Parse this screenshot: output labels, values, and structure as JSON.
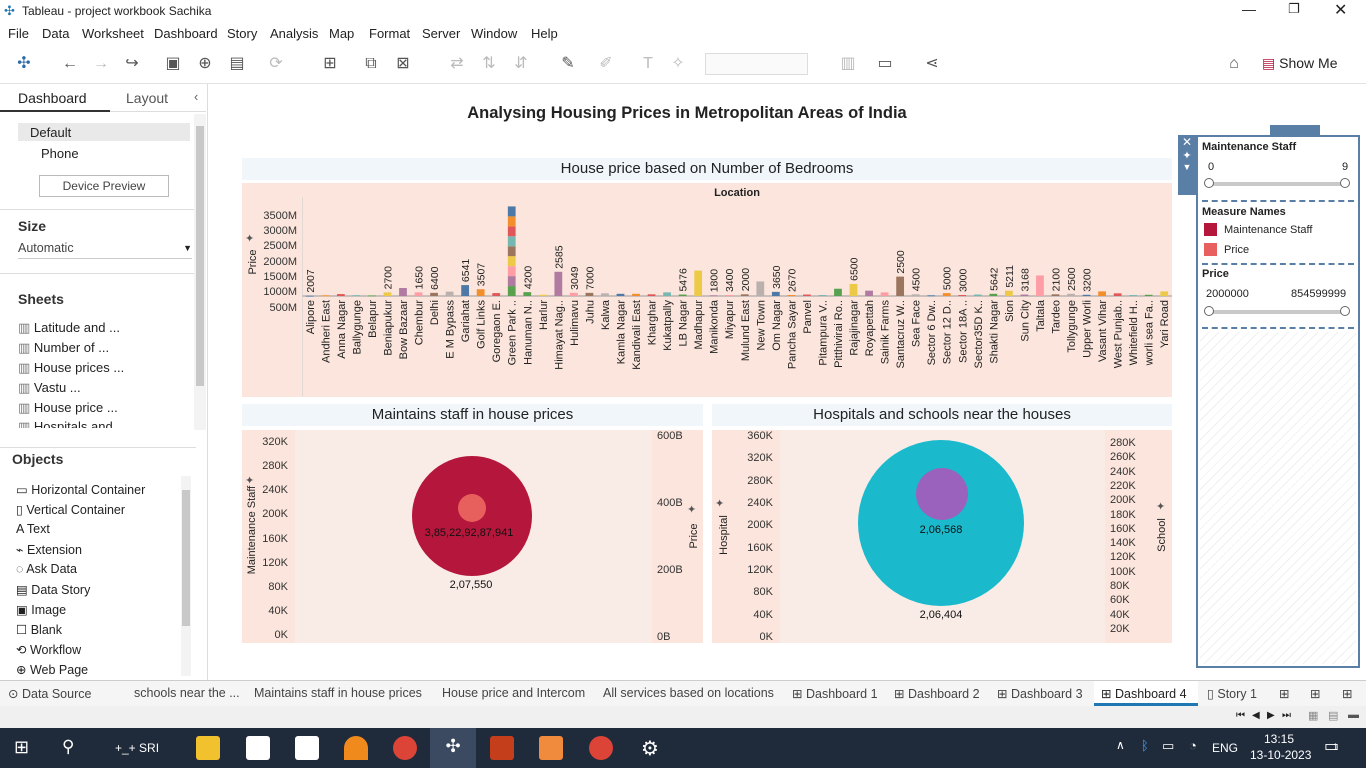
{
  "window": {
    "title": "Tableau - project workbook Sachika"
  },
  "menu": [
    "File",
    "Data",
    "Worksheet",
    "Dashboard",
    "Story",
    "Analysis",
    "Map",
    "Format",
    "Server",
    "Window",
    "Help"
  ],
  "toolbar": {
    "show_me": "Show Me"
  },
  "left": {
    "tab_dashboard": "Dashboard",
    "tab_layout": "Layout",
    "device_default": "Default",
    "device_phone": "Phone",
    "device_preview": "Device Preview",
    "size_header": "Size",
    "size_value": "Automatic",
    "sheets_header": "Sheets",
    "sheets": [
      "Latitude and ...",
      "Number of ...",
      "House prices ...",
      "Vastu ...",
      "House price ...",
      "Hospitals and"
    ],
    "objects_header": "Objects",
    "objects": [
      "Horizontal Container",
      "Vertical Container",
      "Text",
      "Extension",
      "Ask Data",
      "Data Story",
      "Image",
      "Blank",
      "Workflow",
      "Web Page"
    ]
  },
  "dashboard": {
    "title": "Analysing Housing Prices in Metropolitan Areas of India",
    "chart1": {
      "title": "House price based on Number of Bedrooms",
      "column_header": "Location",
      "ylabel": "Price",
      "yticks": [
        "3500M",
        "3000M",
        "2500M",
        "2000M",
        "1500M",
        "1000M",
        "500M"
      ]
    },
    "chart2": {
      "title": "Maintains staff in house prices",
      "ylabel_left": "Maintenance Staff",
      "ylabel_right": "Price",
      "yticks_left": [
        "320K",
        "280K",
        "240K",
        "200K",
        "160K",
        "120K",
        "80K",
        "40K",
        "0K"
      ],
      "yticks_right": [
        "600B",
        "400B",
        "200B",
        "0B"
      ],
      "label_inner": "3,85,22,92,87,941",
      "label_outer": "2,07,550"
    },
    "chart3": {
      "title": "Hospitals and schools near the houses",
      "ylabel_left": "Hospital",
      "ylabel_right": "School",
      "yticks_left": [
        "360K",
        "320K",
        "280K",
        "240K",
        "200K",
        "160K",
        "120K",
        "80K",
        "40K",
        "0K"
      ],
      "yticks_right": [
        "280K",
        "260K",
        "240K",
        "220K",
        "200K",
        "180K",
        "160K",
        "140K",
        "120K",
        "100K",
        "80K",
        "60K",
        "40K",
        "20K"
      ],
      "label_inner": "2,06,568",
      "label_outer": "2,06,404"
    }
  },
  "filters": {
    "maintenance_title": "Maintenance Staff",
    "maintenance_min": "0",
    "maintenance_max": "9",
    "measure_names_title": "Measure Names",
    "measure_items": [
      {
        "label": "Maintenance Staff",
        "color": "#b5163c"
      },
      {
        "label": "Price",
        "color": "#e8605e"
      }
    ],
    "price_title": "Price",
    "price_min": "2000000",
    "price_max": "854599999"
  },
  "chart_data": [
    {
      "type": "bar",
      "title": "House price based on Number of Bedrooms",
      "xlabel": "Location",
      "ylabel": "Price",
      "categories": [
        "Alipore",
        "Andheri East",
        "Anna Nagar",
        "Ballygunge",
        "Belapur",
        "Beniapukur",
        "Bow Bazaar",
        "Chembur",
        "Delhi",
        "E M Bypass",
        "Gariahat",
        "Golf Links",
        "Goregaon E.",
        "Green Park ..",
        "Hanuman N..",
        "Harlur",
        "Himayat Nag..",
        "Hulimavu",
        "Juhu",
        "Kalwa",
        "Kamla Nagar",
        "Kandivali East",
        "Kharghar",
        "Kukatpally",
        "LB Nagar",
        "Madhapur",
        "Manikonda",
        "Miyapur",
        "Mulund East",
        "New Town",
        "Om Nagar",
        "Pancha Sayar",
        "Panvel",
        "Pitampura V..",
        "Pitthivirai Ro..",
        "Rajajinagar",
        "Royapettah",
        "Sainik Farms",
        "Santacruz W..",
        "Sea Face",
        "Sector 6 Dw..",
        "Sector 12 D..",
        "Sector 18A ..",
        "Sector35D K..",
        "Shakti Nagar",
        "Sion",
        "Sun City",
        "Taltala",
        "Tardeo",
        "Tollygunge",
        "Upper Worli",
        "Vasant Vihar",
        "West Punjab..",
        "Whitefield H..",
        "worli sea Fa..",
        "Yari Road"
      ],
      "values": [
        15,
        30,
        80,
        35,
        25,
        150,
        330,
        150,
        130,
        180,
        450,
        280,
        120,
        3700,
        160,
        50,
        1000,
        130,
        130,
        110,
        90,
        90,
        70,
        150,
        60,
        1050,
        30,
        40,
        70,
        600,
        170,
        40,
        60,
        40,
        300,
        500,
        220,
        150,
        800,
        70,
        30,
        120,
        40,
        60,
        90,
        220,
        60,
        850,
        70,
        90,
        50,
        190,
        110,
        40,
        50,
        190
      ],
      "data_labels": [
        "2007",
        "",
        "",
        "",
        "",
        "2700",
        "",
        "1650",
        "6400",
        "",
        "6541",
        "3507",
        "",
        "",
        "4200",
        "",
        "2585",
        "3049",
        "7000",
        "",
        "",
        "",
        "",
        "",
        "5476",
        "",
        "1800",
        "3400",
        "2000",
        "",
        "3650",
        "2670",
        "",
        "",
        "",
        "6500",
        "",
        "",
        "2500",
        "4500",
        "",
        "5000",
        "3000",
        "",
        "5642",
        "5211",
        "3168",
        "",
        "2100",
        "2500",
        "3200",
        ""
      ],
      "ylim": [
        0,
        3800
      ]
    },
    {
      "type": "scatter",
      "title": "Maintains staff in house prices",
      "series": [
        {
          "name": "Maintenance Staff",
          "values": [
            207550
          ]
        },
        {
          "name": "Price",
          "values": [
            38522928794
          ]
        }
      ],
      "ylim_left": [
        0,
        340000
      ],
      "ylim_right": [
        0,
        650
      ]
    },
    {
      "type": "scatter",
      "title": "Hospitals and schools near the houses",
      "series": [
        {
          "name": "Hospital",
          "values": [
            206404
          ]
        },
        {
          "name": "School",
          "values": [
            206568
          ]
        }
      ],
      "ylim_left": [
        0,
        380000
      ],
      "ylim_right": [
        0,
        300000
      ]
    }
  ],
  "tabs": [
    "Data Source",
    "schools near the ...",
    "Maintains staff in house prices",
    "House price and Intercom",
    "All services based on locations",
    "Dashboard 1",
    "Dashboard 2",
    "Dashboard 3",
    "Dashboard 4",
    "Story 1"
  ],
  "taskbar": {
    "user": "+_+ SRI",
    "lang": "ENG",
    "time": "13:15",
    "date": "13-10-2023",
    "notif": "1"
  }
}
